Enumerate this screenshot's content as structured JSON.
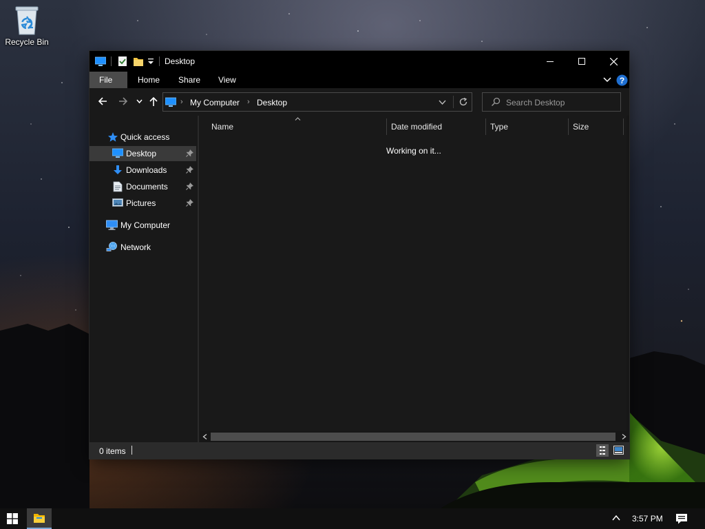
{
  "desktop": {
    "icons": [
      {
        "label": "Recycle Bin",
        "icon": "recycle-bin-icon"
      }
    ]
  },
  "window": {
    "title": "Desktop",
    "ribbon_tabs": [
      "File",
      "Home",
      "Share",
      "View"
    ],
    "nav": {
      "address": {
        "crumbs": [
          "My Computer",
          "Desktop"
        ]
      },
      "search_placeholder": "Search Desktop"
    },
    "nav_pane": {
      "quick_access": {
        "label": "Quick access",
        "items": [
          {
            "label": "Desktop",
            "icon": "desktop-icon",
            "pinned": true,
            "selected": true
          },
          {
            "label": "Downloads",
            "icon": "downloads-icon",
            "pinned": true
          },
          {
            "label": "Documents",
            "icon": "documents-icon",
            "pinned": true
          },
          {
            "label": "Pictures",
            "icon": "pictures-icon",
            "pinned": true
          }
        ]
      },
      "my_computer": {
        "label": "My Computer",
        "icon": "computer-icon"
      },
      "network": {
        "label": "Network",
        "icon": "network-icon"
      }
    },
    "columns": [
      "Name",
      "Date modified",
      "Type",
      "Size"
    ],
    "sort_column": "Name",
    "status_message": "Working on it...",
    "status_bar": {
      "item_count": "0 items"
    }
  },
  "taskbar": {
    "clock": "3:57 PM"
  },
  "colors": {
    "accent": "#1e90ff",
    "window_bg": "#191919",
    "titlebar_bg": "#000000",
    "taskbar_bg": "#101010"
  }
}
